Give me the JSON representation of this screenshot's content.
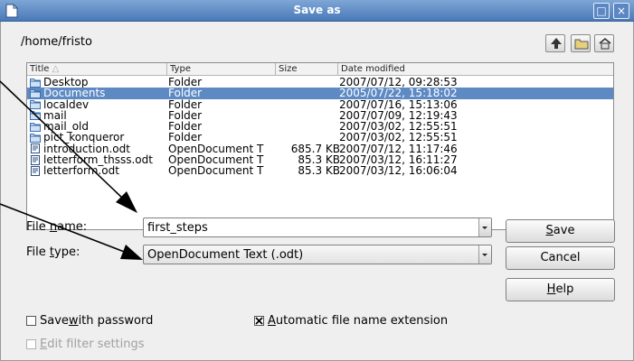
{
  "window": {
    "title": "Save as",
    "buttons": {
      "maximize": "□",
      "close": "×"
    }
  },
  "current_path": "/home/fristo",
  "toolbar": {
    "icons": [
      "up-one-level-icon",
      "new-folder-icon",
      "default-directory-icon"
    ]
  },
  "file_list": {
    "columns": {
      "title": "Title",
      "type": "Type",
      "size": "Size",
      "date": "Date modified"
    },
    "sort_indicator": "△",
    "rows": [
      {
        "name": "Desktop",
        "type": "Folder",
        "size": "",
        "date": "2007/07/12, 09:28:53",
        "kind": "folder",
        "selected": false
      },
      {
        "name": "Documents",
        "type": "Folder",
        "size": "",
        "date": "2005/07/22, 15:18:02",
        "kind": "folder",
        "selected": true
      },
      {
        "name": "localdev",
        "type": "Folder",
        "size": "",
        "date": "2007/07/16, 15:13:06",
        "kind": "folder",
        "selected": false
      },
      {
        "name": "mail",
        "type": "Folder",
        "size": "",
        "date": "2007/07/09, 12:19:43",
        "kind": "folder",
        "selected": false
      },
      {
        "name": "mail_old",
        "type": "Folder",
        "size": "",
        "date": "2007/03/02, 12:55:51",
        "kind": "folder",
        "selected": false
      },
      {
        "name": "pict_konqueror",
        "type": "Folder",
        "size": "",
        "date": "2007/03/02, 12:55:51",
        "kind": "folder",
        "selected": false
      },
      {
        "name": "introduction.odt",
        "type": "OpenDocument T",
        "size": "685.7 KB",
        "date": "2007/07/12, 11:17:46",
        "kind": "document",
        "selected": false
      },
      {
        "name": "letterform_thsss.odt",
        "type": "OpenDocument T",
        "size": "85.3 KB",
        "date": "2007/03/12, 16:11:27",
        "kind": "document",
        "selected": false
      },
      {
        "name": "letterform.odt",
        "type": "OpenDocument T",
        "size": "85.3 KB",
        "date": "2007/03/12, 16:06:04",
        "kind": "document",
        "selected": false
      }
    ]
  },
  "file_name": {
    "label_pre": "File ",
    "label_accel": "n",
    "label_post": "ame:",
    "value": "first_steps"
  },
  "file_type": {
    "label_pre": "File ",
    "label_accel": "t",
    "label_post": "ype:",
    "value": "OpenDocument Text (.odt)"
  },
  "buttons": {
    "save": {
      "accel": "S",
      "rest": "ave"
    },
    "cancel": {
      "label": "Cancel"
    },
    "help": {
      "accel": "H",
      "rest": "elp"
    }
  },
  "options": {
    "save_with_password": {
      "pre": "Save ",
      "accel": "w",
      "post": "ith password",
      "checked": false
    },
    "automatic_extension": {
      "pre": "",
      "accel": "A",
      "post": "utomatic file name extension",
      "checked": true
    },
    "edit_filter_settings": {
      "pre": "",
      "accel": "E",
      "post": "dit filter settings",
      "checked": false,
      "disabled": true
    }
  },
  "colors": {
    "titlebar": "#4a79b8",
    "selection": "#5e8ac4",
    "dialog_bg": "#efefef",
    "annotation_arrow": "#000000"
  }
}
